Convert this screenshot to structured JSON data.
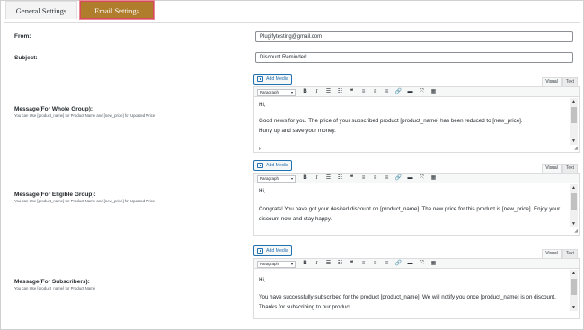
{
  "tabs": {
    "general": "General Settings",
    "email": "Email Settings"
  },
  "fields": {
    "from_label": "From:",
    "from_value": "Plugifytesting@gmail.com",
    "subject_label": "Subject:",
    "subject_value": "Discount Reminder!"
  },
  "editor_common": {
    "add_media": "Add Media",
    "visual_tab": "Visual",
    "text_tab": "Text",
    "format_select": "Paragraph",
    "toolbar_icons": [
      "bold-icon",
      "italic-icon",
      "bullet-list-icon",
      "numbered-list-icon",
      "blockquote-icon",
      "align-left-icon",
      "align-center-icon",
      "align-right-icon",
      "link-icon",
      "read-more-icon",
      "fullscreen-icon",
      "toolbar-toggle-icon"
    ]
  },
  "messages": [
    {
      "label": "Message(For Whole Group):",
      "hint": "You can Use [product_name] for Product Name and [new_price] for Updated Price",
      "lines": [
        "Hi,",
        "Good news for you. The price of your subscribed product [product_name] has been reduced to [new_price].",
        "Hurry up and save your money."
      ],
      "path": "P"
    },
    {
      "label": "Message(For Eligible Group):",
      "hint": "You can Use [product_name] for Product Name and [new_price] for Updated Price",
      "lines": [
        "Hi,",
        "Congrats! You have got your desired discount on [product_name]. The new price for this product is [new_price]. Enjoy your",
        "discount now and stay happy."
      ]
    },
    {
      "label": "Message(For Subscribers):",
      "hint": "You can Use [product_name] for Product Name",
      "lines": [
        "Hi,",
        "You have successfully subscribed for the product [product_name]. We will notify you once [product_name] is on discount.",
        "Thanks for subscribing to our product."
      ]
    }
  ],
  "colors": {
    "active_tab_bg": "#b07d2c",
    "active_tab_border": "#d9495b",
    "link_blue": "#2271b1"
  }
}
